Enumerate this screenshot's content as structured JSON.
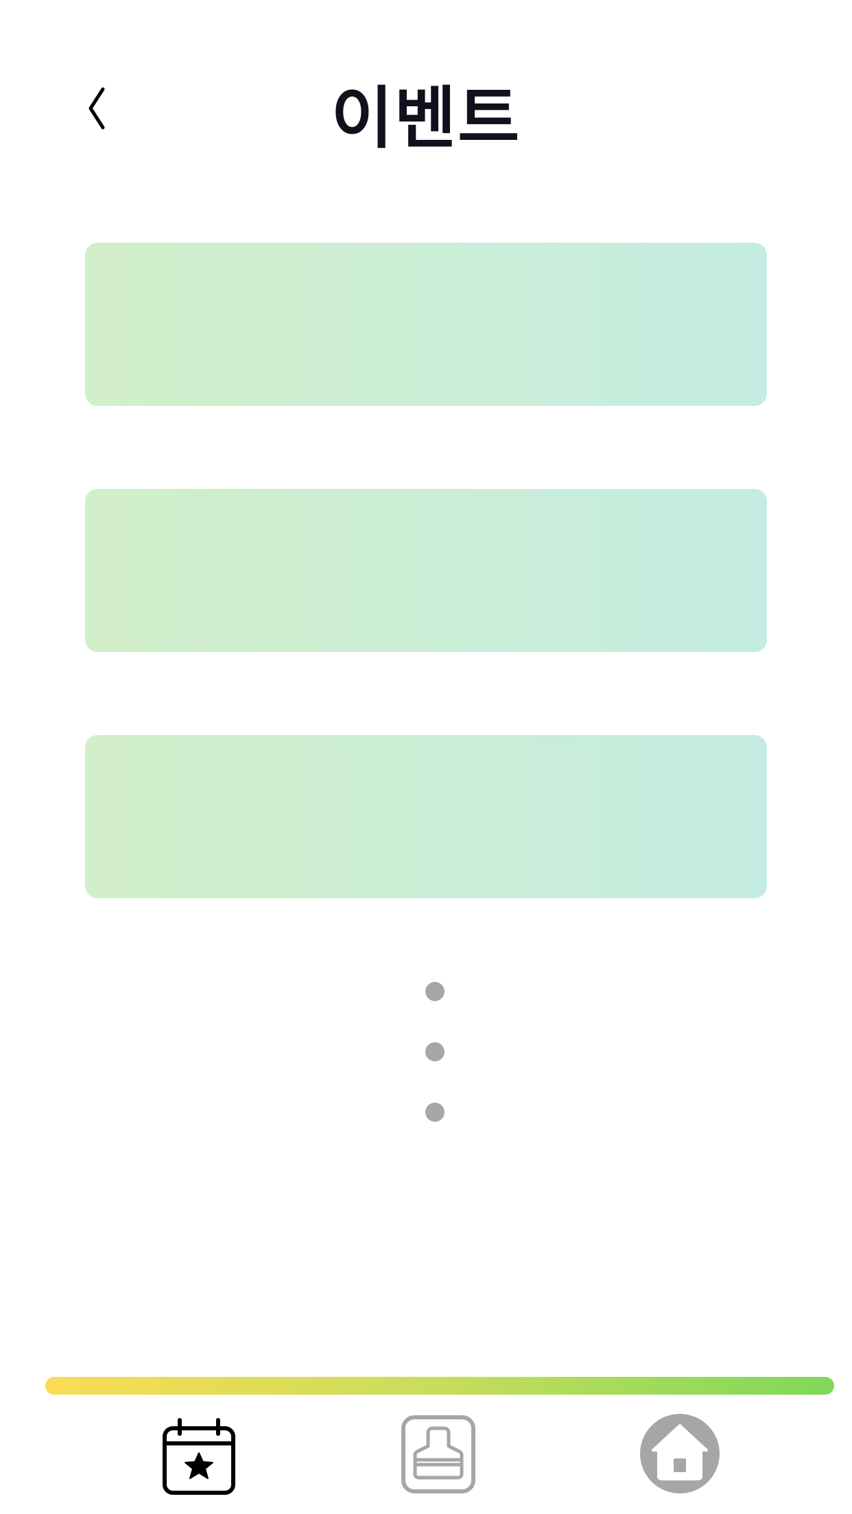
{
  "header": {
    "title": "이벤트",
    "back_icon": "chevron-left-icon"
  },
  "event_list": {
    "items": [
      {
        "name": "event-banner-1"
      },
      {
        "name": "event-banner-2"
      },
      {
        "name": "event-banner-3"
      }
    ],
    "more_indicator_icon": "vertical-ellipsis-icon"
  },
  "colors": {
    "title": "#140f1c",
    "card_gradient_start": "#d2efc9",
    "card_gradient_end": "#c4ece2",
    "dots": "#a6a6a6",
    "bar_gradient_start": "#fbdc55",
    "bar_gradient_end": "#7fd85a",
    "active_tab": "#000000",
    "inactive_tab": "#a6a6a6"
  },
  "bottom_nav": {
    "tabs": [
      {
        "icon": "calendar-star-icon",
        "active": true
      },
      {
        "icon": "shop-stamp-icon",
        "active": false
      },
      {
        "icon": "home-icon",
        "active": false
      }
    ]
  }
}
